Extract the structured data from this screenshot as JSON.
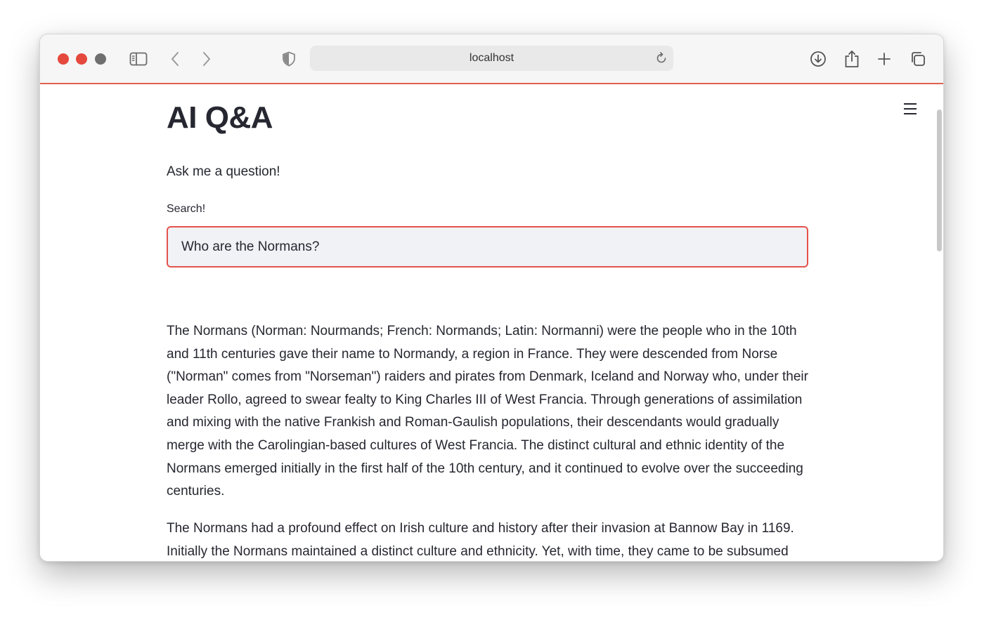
{
  "browser": {
    "url": "localhost",
    "icons": [
      "sidebar-icon",
      "back-icon",
      "forward-icon",
      "shield-icon",
      "reload-icon",
      "download-icon",
      "share-icon",
      "new-tab-icon",
      "tabs-overview-icon"
    ],
    "accent_color": "#e0614f"
  },
  "app": {
    "title": "AI Q&A",
    "subtitle": "Ask me a question!",
    "search": {
      "label": "Search!",
      "value": "Who are the Normans?",
      "border_color": "#e5534b"
    },
    "answer_paragraphs": [
      "The Normans (Norman: Nourmands; French: Normands; Latin: Normanni) were the people who in the 10th and 11th centuries gave their name to Normandy, a region in France. They were descended from Norse (\"Norman\" comes from \"Norseman\") raiders and pirates from Denmark, Iceland and Norway who, under their leader Rollo, agreed to swear fealty to King Charles III of West Francia. Through generations of assimilation and mixing with the native Frankish and Roman-Gaulish populations, their descendants would gradually merge with the Carolingian-based cultures of West Francia. The distinct cultural and ethnic identity of the Normans emerged initially in the first half of the 10th century, and it continued to evolve over the succeeding centuries.",
      "The Normans had a profound effect on Irish culture and history after their invasion at Bannow Bay in 1169. Initially the Normans maintained a distinct culture and ethnicity. Yet, with time, they came to be subsumed into Irish culture to the point that it has been said that they became \"more Irish than the Irish"
    ]
  }
}
